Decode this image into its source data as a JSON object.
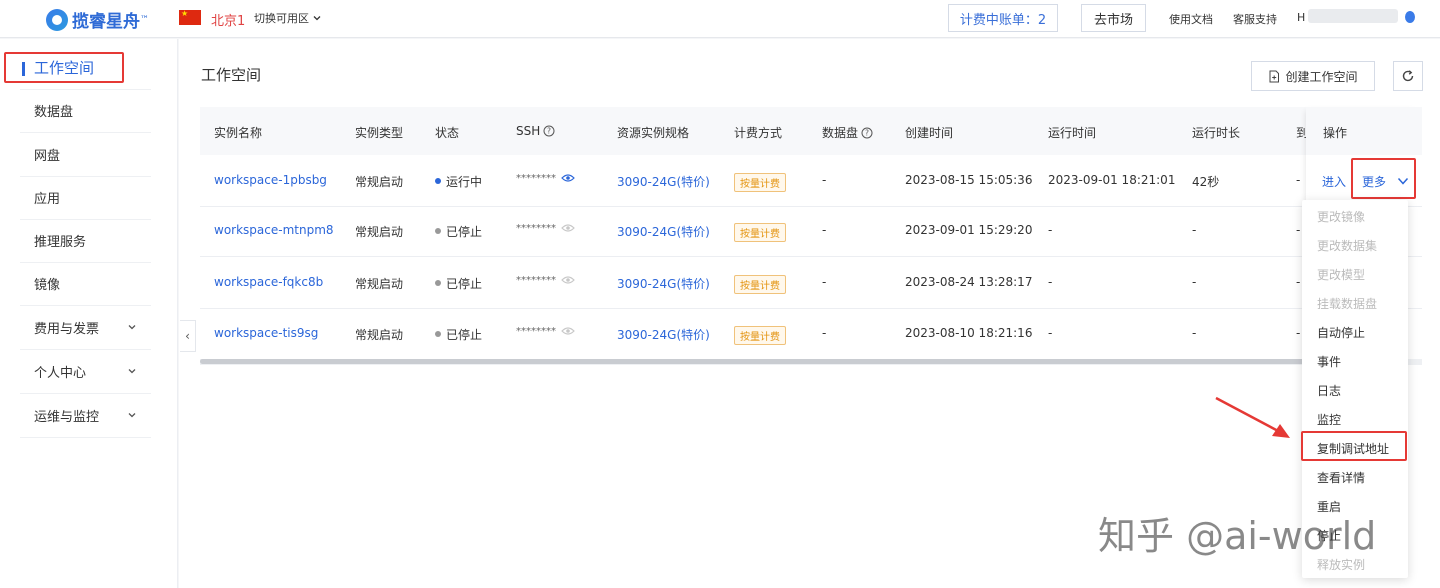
{
  "topbar": {
    "logo_text": "揽睿星舟",
    "logo_tm": "™",
    "region": "北京1",
    "switch_zone": "切换可用区",
    "billing_account": "计费中账单：2",
    "market": "去市场",
    "docs": "使用文档",
    "support": "客服支持",
    "user_initial": "H"
  },
  "sidebar": {
    "items": [
      {
        "label": "工作空间",
        "expandable": false
      },
      {
        "label": "数据盘",
        "expandable": false
      },
      {
        "label": "网盘",
        "expandable": false
      },
      {
        "label": "应用",
        "expandable": false
      },
      {
        "label": "推理服务",
        "expandable": false
      },
      {
        "label": "镜像",
        "expandable": false
      },
      {
        "label": "费用与发票",
        "expandable": true
      },
      {
        "label": "个人中心",
        "expandable": true
      },
      {
        "label": "运维与监控",
        "expandable": true
      }
    ]
  },
  "main": {
    "title": "工作空间",
    "create_button": "创建工作空间",
    "collapse_icon": "‹",
    "table": {
      "headers": [
        "实例名称",
        "实例类型",
        "状态",
        "SSH",
        "资源实例规格",
        "计费方式",
        "数据盘",
        "创建时间",
        "运行时间",
        "运行时长",
        "到",
        "操作"
      ],
      "rows": [
        {
          "name": "workspace-1pbsbg",
          "type": "常规启动",
          "status": "运行中",
          "status_color": "#2b66d9",
          "ssh": "********",
          "spec": "3090-24G(特价)",
          "billing": "按量计费",
          "disk": "-",
          "created": "2023-08-15 15:05:36",
          "run_time": "2023-09-01 18:21:01",
          "duration": "42秒",
          "due": "-"
        },
        {
          "name": "workspace-mtnpm8",
          "type": "常规启动",
          "status": "已停止",
          "status_color": "#999999",
          "ssh": "********",
          "spec": "3090-24G(特价)",
          "billing": "按量计费",
          "disk": "-",
          "created": "2023-09-01 15:29:20",
          "run_time": "-",
          "duration": "-",
          "due": "-"
        },
        {
          "name": "workspace-fqkc8b",
          "type": "常规启动",
          "status": "已停止",
          "status_color": "#999999",
          "ssh": "********",
          "spec": "3090-24G(特价)",
          "billing": "按量计费",
          "disk": "-",
          "created": "2023-08-24 13:28:17",
          "run_time": "-",
          "duration": "-",
          "due": "-"
        },
        {
          "name": "workspace-tis9sg",
          "type": "常规启动",
          "status": "已停止",
          "status_color": "#999999",
          "ssh": "********",
          "spec": "3090-24G(特价)",
          "billing": "按量计费",
          "disk": "-",
          "created": "2023-08-10 18:21:16",
          "run_time": "-",
          "duration": "-",
          "due": "-"
        }
      ],
      "op_enter": "进入",
      "op_more": "更多"
    }
  },
  "dropdown": {
    "items": [
      {
        "label": "更改镜像",
        "disabled": true
      },
      {
        "label": "更改数据集",
        "disabled": true
      },
      {
        "label": "更改模型",
        "disabled": true
      },
      {
        "label": "挂载数据盘",
        "disabled": true
      },
      {
        "label": "自动停止",
        "disabled": false
      },
      {
        "label": "事件",
        "disabled": false
      },
      {
        "label": "日志",
        "disabled": false
      },
      {
        "label": "监控",
        "disabled": false
      },
      {
        "label": "复制调试地址",
        "disabled": false
      },
      {
        "label": "查看详情",
        "disabled": false
      },
      {
        "label": "重启",
        "disabled": false
      },
      {
        "label": "停止",
        "disabled": false
      },
      {
        "label": "释放实例",
        "disabled": true
      }
    ]
  },
  "watermark": "知乎 @ai-world",
  "colors": {
    "accent": "#2b66d9",
    "highlight": "#e53935",
    "tag": "#e3930f",
    "region": "#e04444"
  }
}
